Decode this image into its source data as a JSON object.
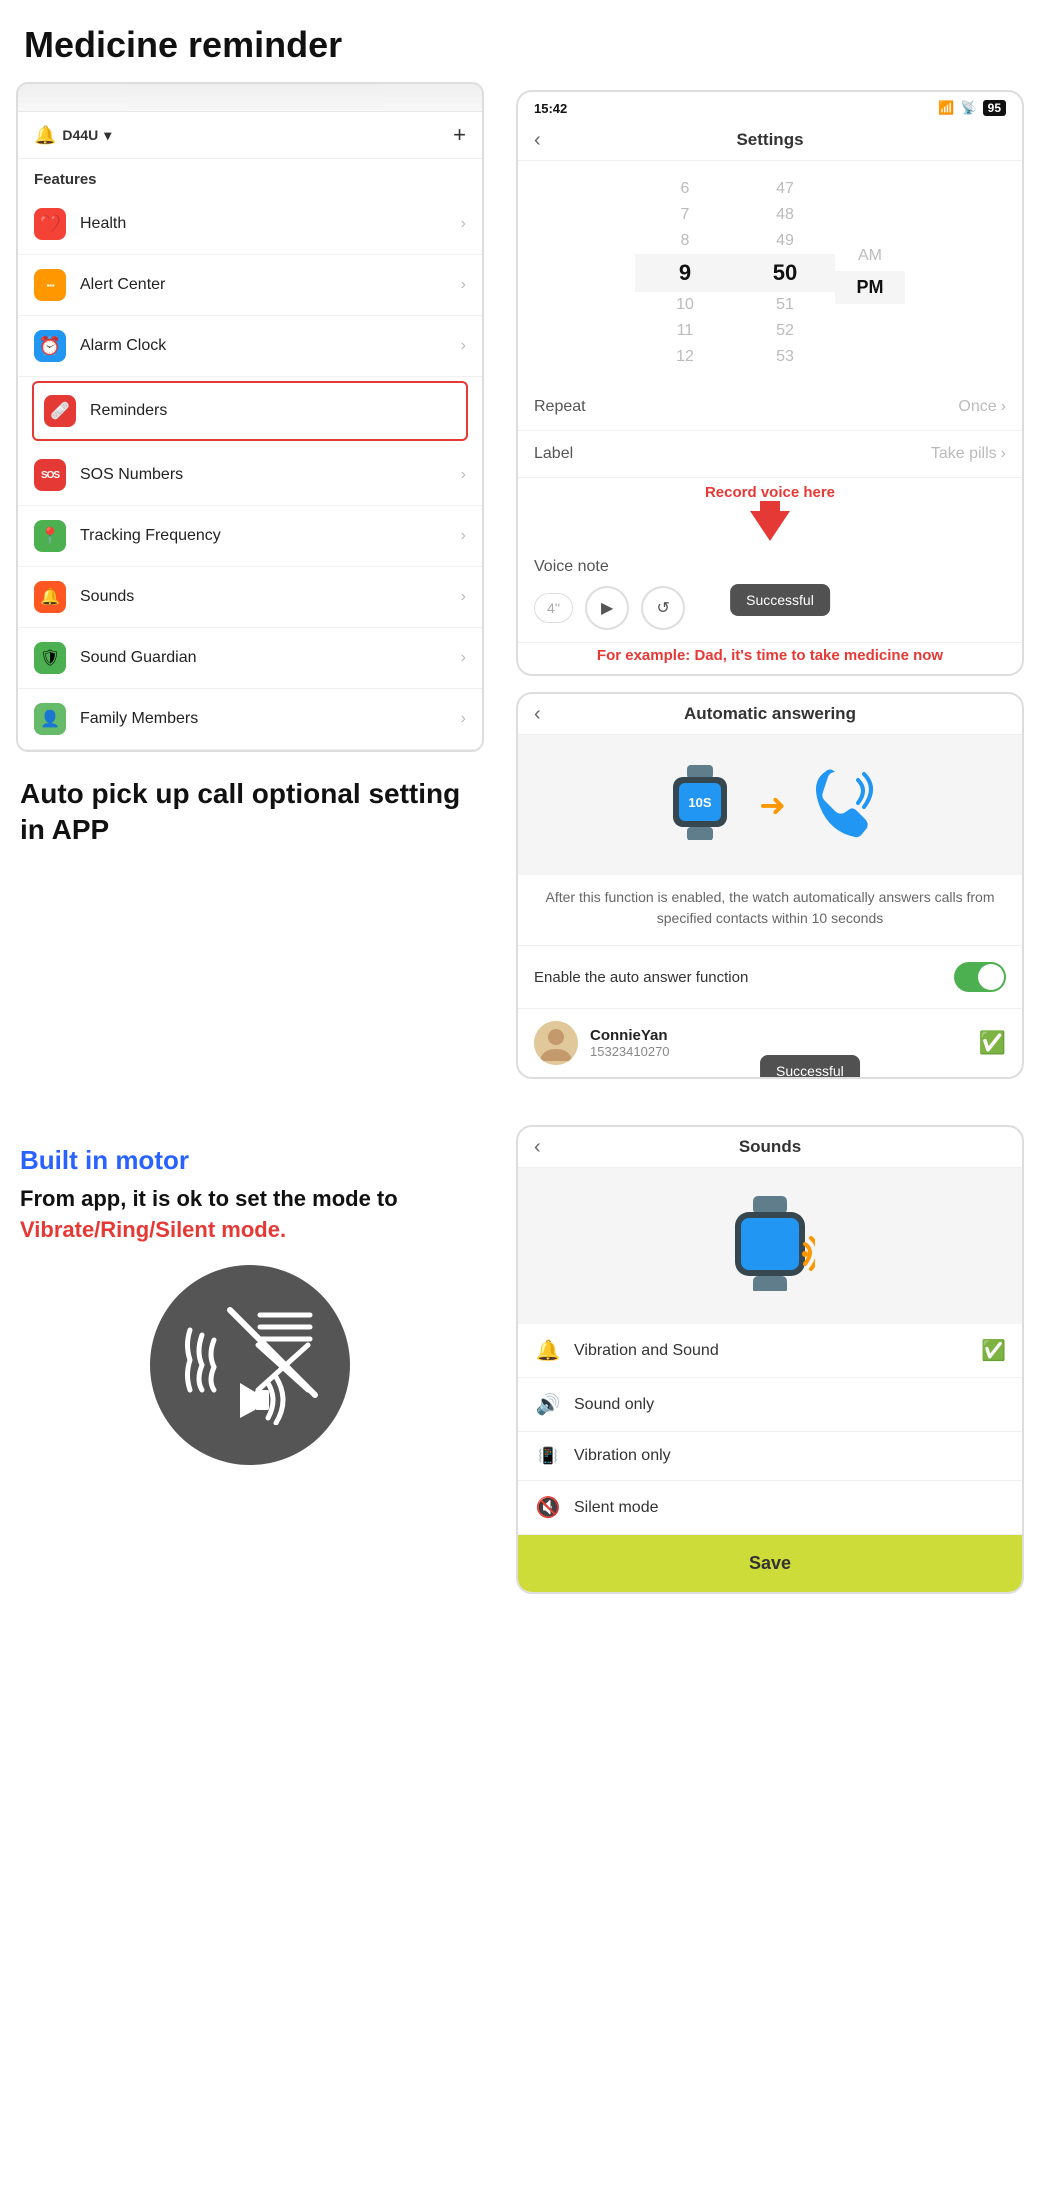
{
  "page": {
    "title": "Medicine reminder"
  },
  "left": {
    "device_name": "D44U",
    "plus_btn": "+",
    "features_label": "Features",
    "menu_items": [
      {
        "id": "health",
        "label": "Health",
        "icon_type": "red",
        "icon_char": "♥",
        "highlighted": false
      },
      {
        "id": "alert-center",
        "label": "Alert Center",
        "icon_type": "orange",
        "icon_char": "⋯",
        "highlighted": false
      },
      {
        "id": "alarm-clock",
        "label": "Alarm Clock",
        "icon_type": "blue",
        "icon_char": "⏰",
        "highlighted": false
      },
      {
        "id": "reminders",
        "label": "Reminders",
        "icon_type": "dark-red",
        "icon_char": "🩹",
        "highlighted": true
      },
      {
        "id": "sos-numbers",
        "label": "SOS Numbers",
        "icon_type": "red-sos",
        "icon_char": "SOS",
        "highlighted": false
      },
      {
        "id": "tracking-frequency",
        "label": "Tracking Frequency",
        "icon_type": "green",
        "icon_char": "📍",
        "highlighted": false
      },
      {
        "id": "sounds",
        "label": "Sounds",
        "icon_type": "orange-sound",
        "icon_char": "🔔",
        "highlighted": false
      },
      {
        "id": "sound-guardian",
        "label": "Sound Guardian",
        "icon_type": "green-shield",
        "icon_char": "🛡",
        "highlighted": false
      },
      {
        "id": "family-members",
        "label": "Family Members",
        "icon_type": "green-person",
        "icon_char": "👤",
        "highlighted": false
      }
    ]
  },
  "right": {
    "settings_screen": {
      "status_time": "15:42",
      "battery": "95",
      "header_title": "Settings",
      "time_picker": {
        "hours": [
          "6",
          "7",
          "8",
          "9",
          "10",
          "11",
          "12"
        ],
        "minutes": [
          "47",
          "48",
          "49",
          "50",
          "51",
          "52",
          "53"
        ],
        "selected_hour": "9",
        "selected_minute": "50",
        "ampm_options": [
          "AM",
          "PM"
        ],
        "selected_ampm": "PM"
      },
      "repeat_label": "Repeat",
      "repeat_value": "Once",
      "label_label": "Label",
      "label_value": "Take pills",
      "voice_note_label": "Voice note",
      "voice_duration": "4''",
      "successful_tooltip": "Successful",
      "annotation_record": "Record voice here",
      "annotation_example": "For example: Dad, it's time to take medicine now"
    },
    "auto_answer_screen": {
      "header_title": "Automatic answering",
      "description": "After this function is enabled, the watch automatically answers calls from specified contacts within 10 seconds",
      "toggle_label": "Enable the auto answer function",
      "contact_name": "ConnieYan",
      "contact_phone": "15323410270",
      "contact_tooltip": "Successful"
    },
    "left_text": {
      "auto_pickup_title": "Auto pick up call optional setting in APP",
      "built_in_motor": "Built in motor",
      "mode_desc_1": "From app, it is ok to set the mode to",
      "mode_highlight": "Vibrate/Ring/Silent mode."
    },
    "sounds_screen": {
      "header_title": "Sounds",
      "options": [
        {
          "id": "vibration-and-sound",
          "label": "Vibration and Sound",
          "selected": true,
          "icon": "🔔"
        },
        {
          "id": "sound-only",
          "label": "Sound only",
          "selected": false,
          "icon": "🔊"
        },
        {
          "id": "vibration-only",
          "label": "Vibration only",
          "selected": false,
          "icon": "📳"
        },
        {
          "id": "silent-mode",
          "label": "Silent mode",
          "selected": false,
          "icon": "🔇"
        }
      ],
      "save_label": "Save"
    }
  }
}
